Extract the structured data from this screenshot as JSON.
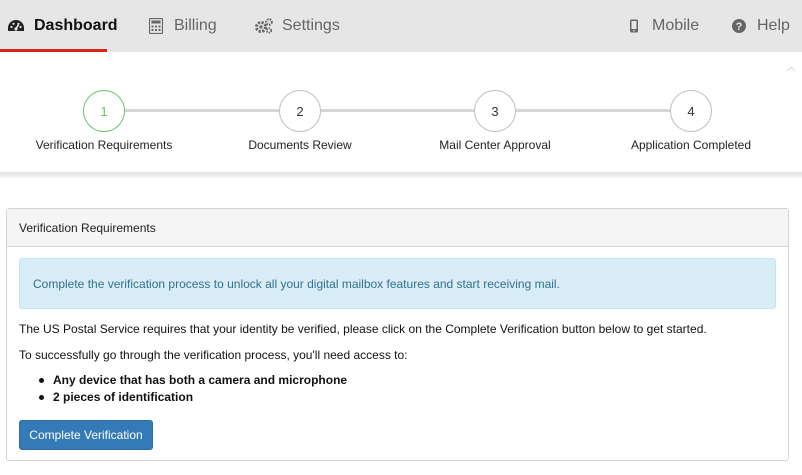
{
  "nav": {
    "dashboard": "Dashboard",
    "billing": "Billing",
    "settings": "Settings",
    "mobile": "Mobile",
    "help": "Help"
  },
  "icons": {
    "dashboard": "tachometer-icon",
    "billing": "calculator-icon",
    "settings": "gears-icon",
    "mobile": "mobile-phone-icon",
    "help": "question-circle-icon"
  },
  "colors": {
    "active_tab_underline": "#d9261c",
    "active_step": "#6cc06a",
    "primary_button": "#337ab7",
    "info_alert_bg": "#d9edf7",
    "info_alert_text": "#31708f"
  },
  "stepper": {
    "steps": [
      {
        "number": "1",
        "label": "Verification Requirements"
      },
      {
        "number": "2",
        "label": "Documents Review"
      },
      {
        "number": "3",
        "label": "Mail Center Approval"
      },
      {
        "number": "4",
        "label": "Application Completed"
      }
    ]
  },
  "panel": {
    "title": "Verification Requirements",
    "alert": "Complete the verification process to unlock all your digital mailbox features and start receiving mail.",
    "paragraph1": "The US Postal Service requires that your identity be verified, please click on the Complete Verification button below to get started.",
    "paragraph2": "To successfully go through the verification process, you'll need access to:",
    "requirements": [
      "Any device that has both a camera and microphone",
      "2 pieces of identification"
    ],
    "button": "Complete Verification"
  }
}
